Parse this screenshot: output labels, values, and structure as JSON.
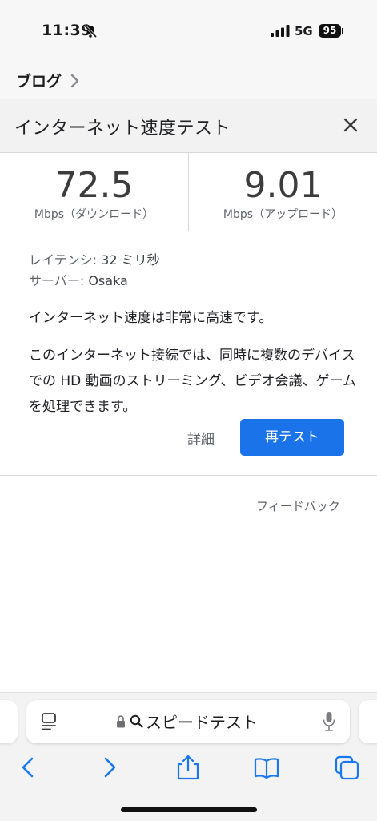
{
  "status_bar": {
    "time": "11:39",
    "network": "5G",
    "battery": "95"
  },
  "breadcrumb": {
    "label": "ブログ"
  },
  "speedtest": {
    "title": "インターネット速度テスト",
    "download": {
      "value": "72.5",
      "label": "Mbps（ダウンロード）"
    },
    "upload": {
      "value": "9.01",
      "label": "Mbps（アップロード）"
    },
    "latency": {
      "label": "レイテンシ:",
      "value": "32 ミリ秒"
    },
    "server": {
      "label": "サーバー:",
      "value": "Osaka"
    },
    "summary": "インターネット速度は非常に高速です。",
    "description": "このインターネット接続では、同時に複数のデバイスでの HD 動画のストリーミング、ビデオ会議、ゲームを処理できます。",
    "details_label": "詳細",
    "retest_label": "再テスト",
    "feedback_label": "フィードバック"
  },
  "browser": {
    "address": "スピードテスト"
  },
  "colors": {
    "accent": "#1a73e8",
    "header_bg": "#f2f2f2",
    "chrome_bg": "#f7f7f7",
    "link": "#1877f2"
  }
}
